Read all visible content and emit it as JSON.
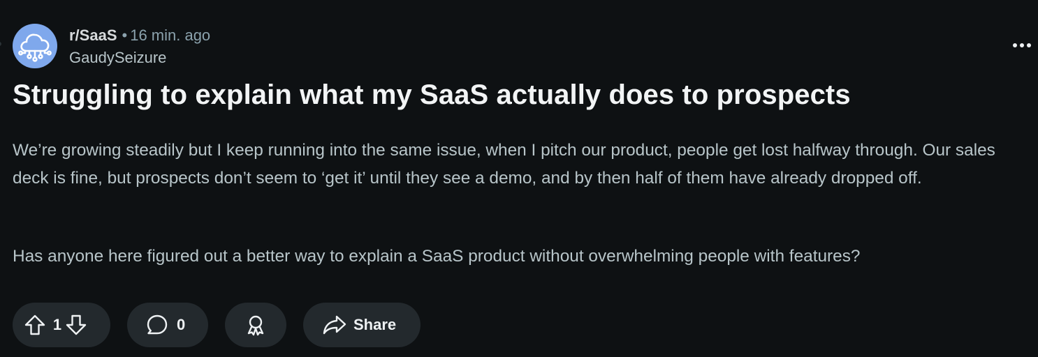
{
  "community": {
    "name": "r/SaaS",
    "separator": "•",
    "time_ago": "16 min. ago",
    "author": "GaudySeizure",
    "avatar_icon": "cloud-network-icon",
    "avatar_color": "#7fa8ec"
  },
  "post": {
    "title": "Struggling to explain what my SaaS actually does to prospects",
    "paragraphs": [
      "We’re growing steadily but I keep running into the same issue, when I pitch our product, people get lost halfway through. Our sales deck is fine, but prospects don’t seem to ‘get it’ until they see a demo, and by then half of them have already dropped off.",
      "Has anyone here figured out a better way to explain a SaaS product without overwhelming people with features?"
    ]
  },
  "actions": {
    "vote_count": "1",
    "comment_count": "0",
    "share_label": "Share",
    "icons": [
      "upvote-icon",
      "downvote-icon",
      "comment-icon",
      "award-icon",
      "share-icon",
      "more-options-icon"
    ]
  },
  "colors": {
    "background": "#0e1113",
    "button_background": "#23292d",
    "text_primary": "#f2f4f5",
    "text_secondary": "#b8c5c9"
  }
}
